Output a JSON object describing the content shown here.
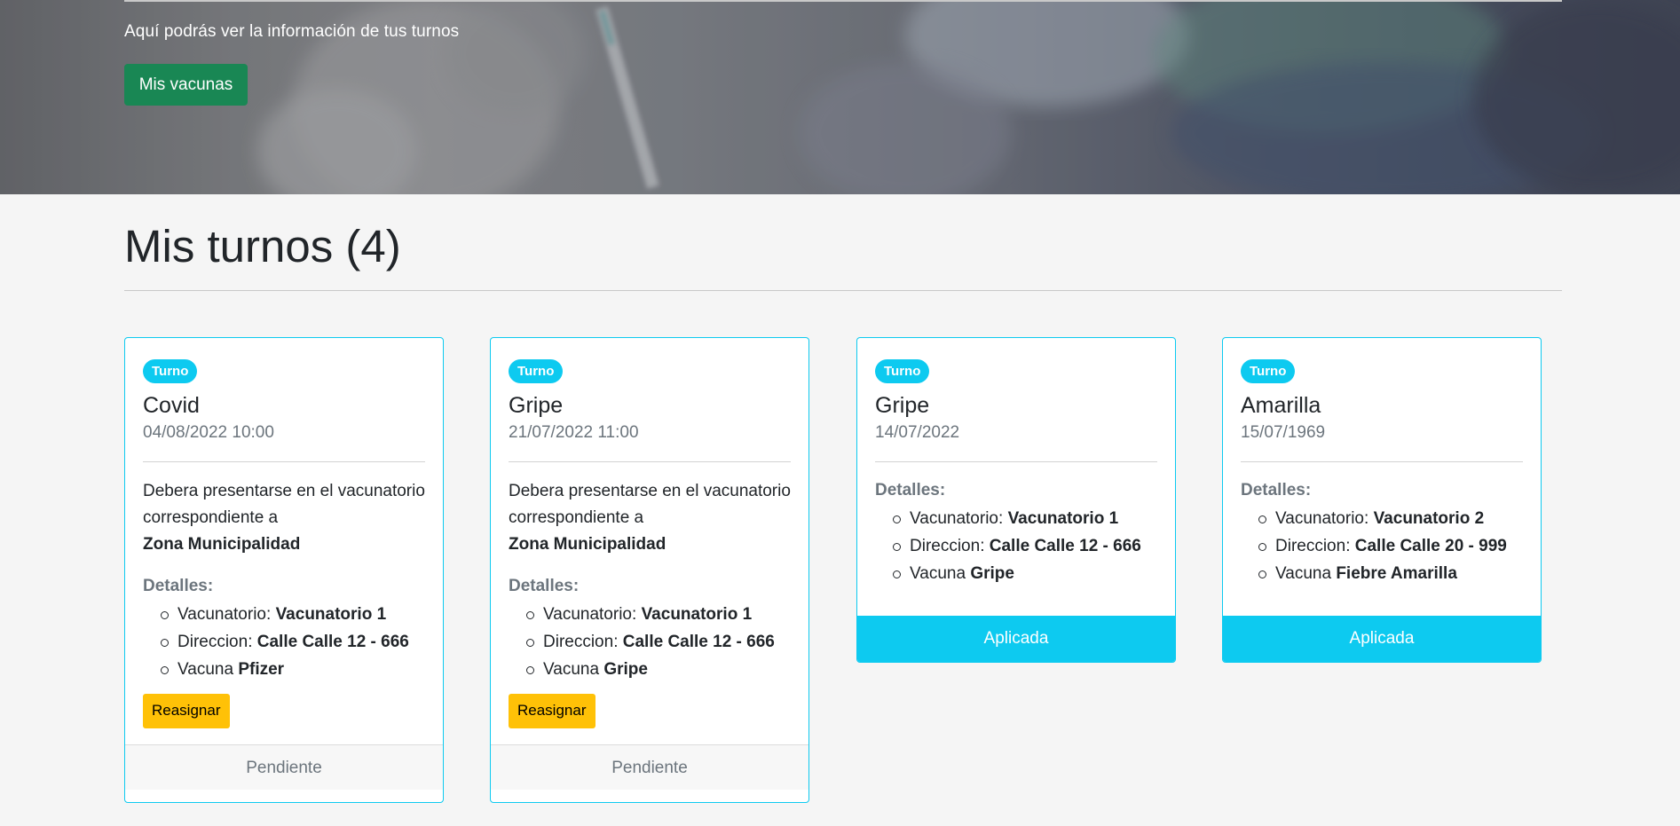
{
  "hero": {
    "subtitle": "Aquí podrás ver la información de tus turnos",
    "button_label": "Mis vacunas"
  },
  "section": {
    "title": "Mis turnos (4)"
  },
  "colors": {
    "primary_green": "#198754",
    "info_cyan": "#0dcaf0",
    "warning_yellow": "#ffc107",
    "muted_text": "#6c757d"
  },
  "cards": [
    {
      "badge": "Turno",
      "title": "Covid",
      "date": "04/08/2022 10:00",
      "text_prefix": "Debera presentarse en el vacunatorio correspondiente a",
      "text_zone": "Zona Municipalidad",
      "details_label": "Detalles:",
      "details": [
        {
          "label": "Vacunatorio:",
          "value": "Vacunatorio 1"
        },
        {
          "label": "Direccion:",
          "value": "Calle Calle 12 - 666"
        },
        {
          "label": "Vacuna",
          "value": "Pfizer"
        }
      ],
      "action_label": "Reasignar",
      "footer": "Pendiente"
    },
    {
      "badge": "Turno",
      "title": "Gripe",
      "date": "21/07/2022 11:00",
      "text_prefix": "Debera presentarse en el vacunatorio correspondiente a",
      "text_zone": "Zona Municipalidad",
      "details_label": "Detalles:",
      "details": [
        {
          "label": "Vacunatorio:",
          "value": "Vacunatorio 1"
        },
        {
          "label": "Direccion:",
          "value": "Calle Calle 12 - 666"
        },
        {
          "label": "Vacuna",
          "value": "Gripe"
        }
      ],
      "action_label": "Reasignar",
      "footer": "Pendiente"
    },
    {
      "badge": "Turno",
      "title": "Gripe",
      "date": "14/07/2022",
      "details_label": "Detalles:",
      "details": [
        {
          "label": "Vacunatorio:",
          "value": "Vacunatorio 1"
        },
        {
          "label": "Direccion:",
          "value": "Calle Calle 12 - 666"
        },
        {
          "label": "Vacuna",
          "value": "Gripe"
        }
      ],
      "footer": "Aplicada"
    },
    {
      "badge": "Turno",
      "title": "Amarilla",
      "date": "15/07/1969",
      "details_label": "Detalles:",
      "details": [
        {
          "label": "Vacunatorio:",
          "value": "Vacunatorio 2"
        },
        {
          "label": "Direccion:",
          "value": "Calle Calle 20 - 999"
        },
        {
          "label": "Vacuna",
          "value": "Fiebre Amarilla"
        }
      ],
      "footer": "Aplicada"
    }
  ]
}
